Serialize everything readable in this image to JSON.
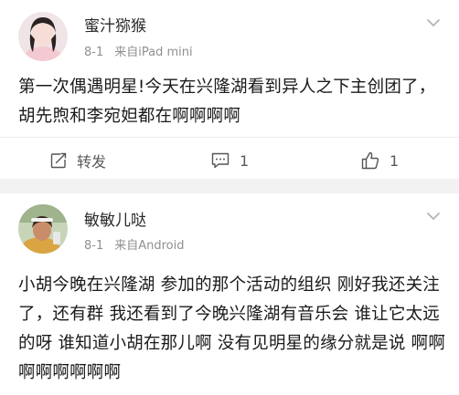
{
  "posts": [
    {
      "author": "蜜汁猕猴",
      "date": "8-1",
      "source": "来自iPad mini",
      "text": "第一次偶遇明星!今天在兴隆湖看到异人之下主创团了，胡先煦和李宛妲都在啊啊啊啊",
      "actions": {
        "repost_label": "转发",
        "comment_count": "1",
        "like_count": "1"
      }
    },
    {
      "author": "敏敏儿哒",
      "date": "8-1",
      "source": "来自Android",
      "text": "小胡今晚在兴隆湖 参加的那个活动的组织 刚好我还关注了，还有群 我还看到了今晚兴隆湖有音乐会 谁让它太远的呀 谁知道小胡在那儿啊 没有见明星的缘分就是说 啊啊啊啊啊啊啊啊"
    }
  ],
  "icons": {
    "menu": "chevron-down-icon",
    "repost": "repost-icon",
    "comment": "comment-icon",
    "like": "like-icon"
  },
  "colors": {
    "meta_text": "#8f8f8f",
    "body_text": "#1a1a1a",
    "separator_band": "#f2f2f2"
  }
}
